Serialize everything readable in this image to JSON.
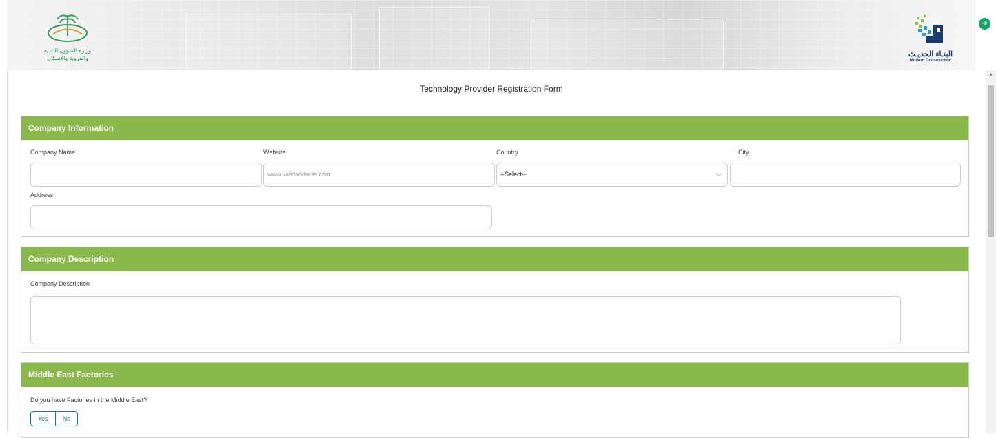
{
  "header": {
    "left_logo": {
      "icon": "ministry-emblem-icon",
      "text_line1": "وزارة الشؤون البلدية",
      "text_line2": "والقروية والإسكان"
    },
    "right_logo": {
      "icon": "modern-construction-logo-icon",
      "arabic": "البنـاء الحديـث",
      "english": "Modern Construction"
    },
    "exit_icon": "exit-arrow-icon"
  },
  "form": {
    "title": "Technology Provider Registration Form",
    "company_information": {
      "heading": "Company Information",
      "company_name_label": "Company Name",
      "company_name_value": "",
      "website_label": "Website",
      "website_placeholder": "www.validaddress.com",
      "country_label": "Country",
      "country_selected": "--Select--",
      "city_label": "City",
      "city_value": "",
      "address_label": "Address",
      "address_value": ""
    },
    "company_description": {
      "heading": "Company Description",
      "label": "Company Description",
      "value": ""
    },
    "middle_east_factories": {
      "heading": "Middle East Factories",
      "question": "Do you have Factories in the Middle East?",
      "options": [
        "Yes",
        "No"
      ]
    }
  },
  "colors": {
    "section_header": "#8bb84a",
    "toggle_border": "#2c7a58",
    "exit_button": "#16a36a"
  }
}
